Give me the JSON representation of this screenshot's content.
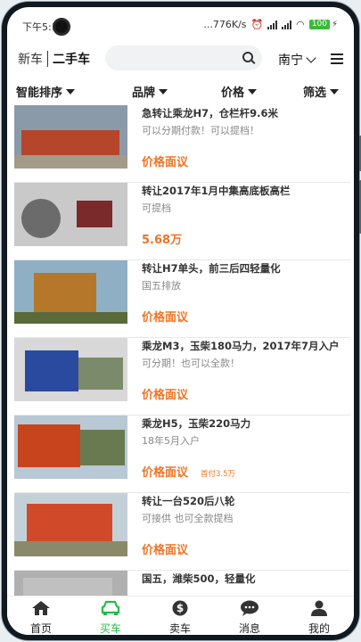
{
  "status_bar": {
    "time": "下午5:18",
    "net_speed": "...776K/s",
    "battery": "100"
  },
  "header": {
    "tab_new": "新车",
    "tab_used": "二手车",
    "search_placeholder": "",
    "city": "南宁"
  },
  "filters": [
    "智能排序",
    "品牌",
    "价格",
    "筛选"
  ],
  "listings": [
    {
      "title": "急转让乘龙H7，仓栏杆9.6米",
      "subtitle": "可以分期付款！可以提档！",
      "price": "价格面议",
      "down_payment": "",
      "colors": [
        "#8a9aa8",
        "#b5462b",
        "#a39a8a"
      ]
    },
    {
      "title": "转让2017年1月中集高底板高栏",
      "subtitle": "可提档",
      "price": "5.68万",
      "down_payment": "",
      "colors": [
        "#c9c9c9",
        "#7a2a2a",
        "#6b6b6b"
      ]
    },
    {
      "title": "转让H7单头，前三后四轻量化",
      "subtitle": "国五排放",
      "price": "价格面议",
      "down_payment": "",
      "colors": [
        "#8fb0c4",
        "#b5782a",
        "#5a6a3a"
      ]
    },
    {
      "title": "乘龙M3，玉柴180马力，2017年7月入户",
      "subtitle": "可分期！也可以全款！",
      "price": "价格面议",
      "down_payment": "",
      "colors": [
        "#d8d8d8",
        "#2a4aa0",
        "#7a8a6a"
      ]
    },
    {
      "title": "乘龙H5，玉柴220马力",
      "subtitle": "18年5月入户",
      "price": "价格面议",
      "down_payment": "首付3.5万",
      "colors": [
        "#b8c8d4",
        "#c8441c",
        "#6a7a50"
      ]
    },
    {
      "title": "转让一台520后八轮",
      "subtitle": "可接供 也可全款提档",
      "price": "价格面议",
      "down_payment": "",
      "colors": [
        "#c4d0d8",
        "#d04a2a",
        "#8a8a6a"
      ]
    },
    {
      "title": "国五，潍柴500，轻量化",
      "subtitle": "",
      "price": "",
      "down_payment": "",
      "colors": [
        "#b0b0b0",
        "#c0c0c0",
        "#9a9a9a"
      ]
    }
  ],
  "nav": {
    "items": [
      {
        "label": "首页",
        "icon": "home-icon"
      },
      {
        "label": "买车",
        "icon": "car-icon"
      },
      {
        "label": "卖车",
        "icon": "dollar-icon"
      },
      {
        "label": "消息",
        "icon": "chat-icon"
      },
      {
        "label": "我的",
        "icon": "user-icon"
      }
    ],
    "active": "买车",
    "active_color": "#27b84a"
  },
  "accent_color": "#f07424"
}
